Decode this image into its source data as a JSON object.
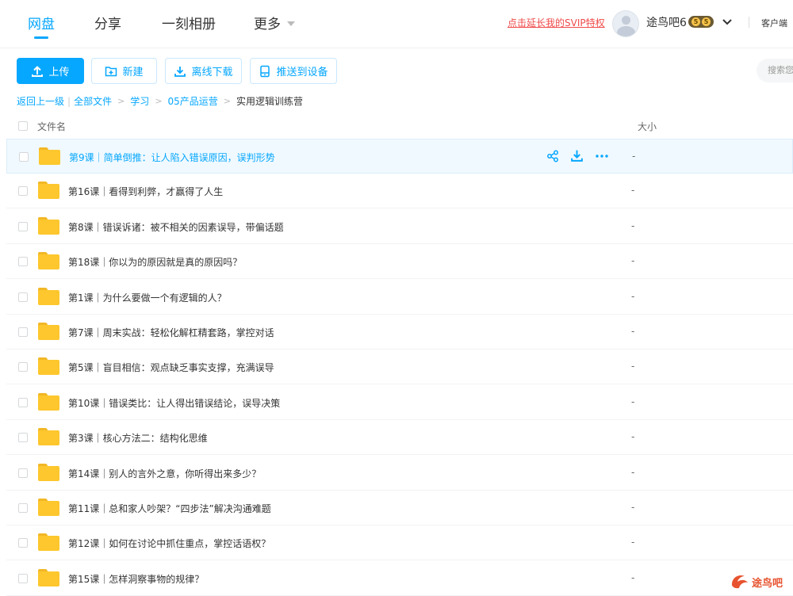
{
  "nav": {
    "tabs": [
      "网盘",
      "分享",
      "一刻相册",
      "更多"
    ],
    "active": "网盘"
  },
  "header": {
    "svip_link": "点击延长我的SVIP特权",
    "username": "途鸟吧6",
    "vip_level": "5",
    "client_label": "客户端"
  },
  "toolbar": {
    "upload": "上传",
    "new": "新建",
    "offline_download": "离线下载",
    "push_device": "推送到设备",
    "search_placeholder": "搜索您"
  },
  "breadcrumb": {
    "back": "返回上一级",
    "all_files": "全部文件",
    "level1": "学习",
    "level2": "05产品运营",
    "current": "实用逻辑训练营"
  },
  "list": {
    "col_name": "文件名",
    "col_size": "大小",
    "rows": [
      {
        "name": "第9课｜简单倒推：让人陷入错误原因，误判形势",
        "size": "-"
      },
      {
        "name": "第16课｜看得到利弊，才赢得了人生",
        "size": "-"
      },
      {
        "name": "第8课｜错误诉诸：被不相关的因素误导，带偏话题",
        "size": "-"
      },
      {
        "name": "第18课｜你以为的原因就是真的原因吗？",
        "size": "-"
      },
      {
        "name": "第1课｜为什么要做一个有逻辑的人？",
        "size": "-"
      },
      {
        "name": "第7课｜周末实战：轻松化解杠精套路，掌控对话",
        "size": "-"
      },
      {
        "name": "第5课｜盲目相信：观点缺乏事实支撑，充满误导",
        "size": "-"
      },
      {
        "name": "第10课｜错误类比：让人得出错误结论，误导决策",
        "size": "-"
      },
      {
        "name": "第3课｜核心方法二：结构化思维",
        "size": "-"
      },
      {
        "name": "第14课｜别人的言外之意，你听得出来多少？",
        "size": "-"
      },
      {
        "name": "第11课｜总和家人吵架？“四步法”解决沟通难题",
        "size": "-"
      },
      {
        "name": "第12课｜如何在讨论中抓住重点，掌控话语权？",
        "size": "-"
      },
      {
        "name": "第15课｜怎样洞察事物的规律？",
        "size": "-"
      }
    ]
  },
  "watermark": {
    "text": "途鸟吧"
  },
  "colors": {
    "accent": "#06a7ff",
    "svip": "#f04a4a",
    "folder": "#fdc72d"
  }
}
